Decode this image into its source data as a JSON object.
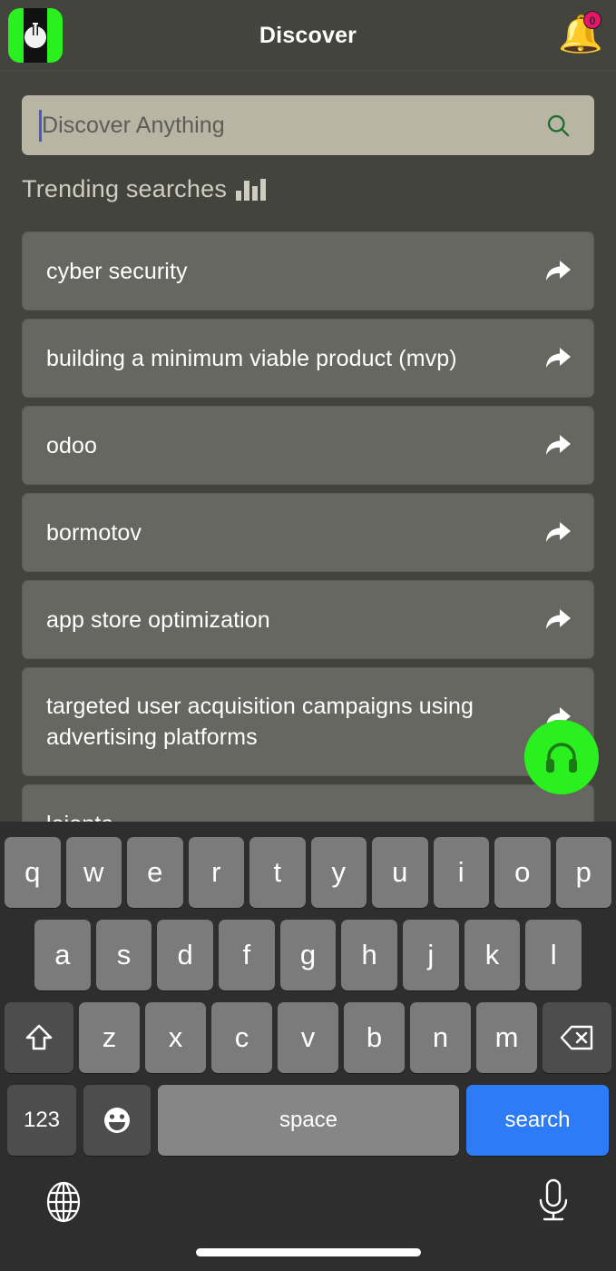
{
  "header": {
    "title": "Discover",
    "logo_icon": "app-logo-power-icon",
    "notification": {
      "icon": "bell-icon",
      "badge_count": "0"
    }
  },
  "search": {
    "placeholder": "Discover Anything",
    "value": "",
    "icon": "search-icon",
    "icon_color": "#1f6b2e",
    "field_color": "#b8b5a4"
  },
  "trending": {
    "title": "Trending searches",
    "icon": "bar-chart-icon",
    "share_icon": "share-arrow-icon",
    "items": [
      {
        "label": "cyber security"
      },
      {
        "label": "building a minimum viable product (mvp)"
      },
      {
        "label": "odoo"
      },
      {
        "label": "bormotov"
      },
      {
        "label": "app store optimization"
      },
      {
        "label": "targeted user acquisition campaigns using advertising platforms"
      },
      {
        "label": "lejonta"
      },
      {
        "label": ""
      }
    ]
  },
  "fab": {
    "icon": "headphones-icon",
    "color": "#2bf020"
  },
  "keyboard": {
    "row1": [
      "q",
      "w",
      "e",
      "r",
      "t",
      "y",
      "u",
      "i",
      "o",
      "p"
    ],
    "row2": [
      "a",
      "s",
      "d",
      "f",
      "g",
      "h",
      "j",
      "k",
      "l"
    ],
    "row3_letters": [
      "z",
      "x",
      "c",
      "v",
      "b",
      "n",
      "m"
    ],
    "shift_icon": "shift-arrow-icon",
    "backspace_icon": "backspace-icon",
    "numbers_label": "123",
    "emoji_icon": "emoji-smiley-icon",
    "space_label": "space",
    "search_label": "search",
    "search_key_color": "#2d7bf6"
  },
  "bottom_bar": {
    "globe_icon": "globe-icon",
    "mic_icon": "microphone-icon",
    "home_indicator": "home-indicator"
  },
  "theme": {
    "background": "#44443f",
    "list_item": "#656760",
    "keyboard_bg": "#2e2e2e",
    "accent_green": "#2bf020",
    "accent_blue": "#2d7bf6",
    "badge_pink": "#e8156b"
  }
}
